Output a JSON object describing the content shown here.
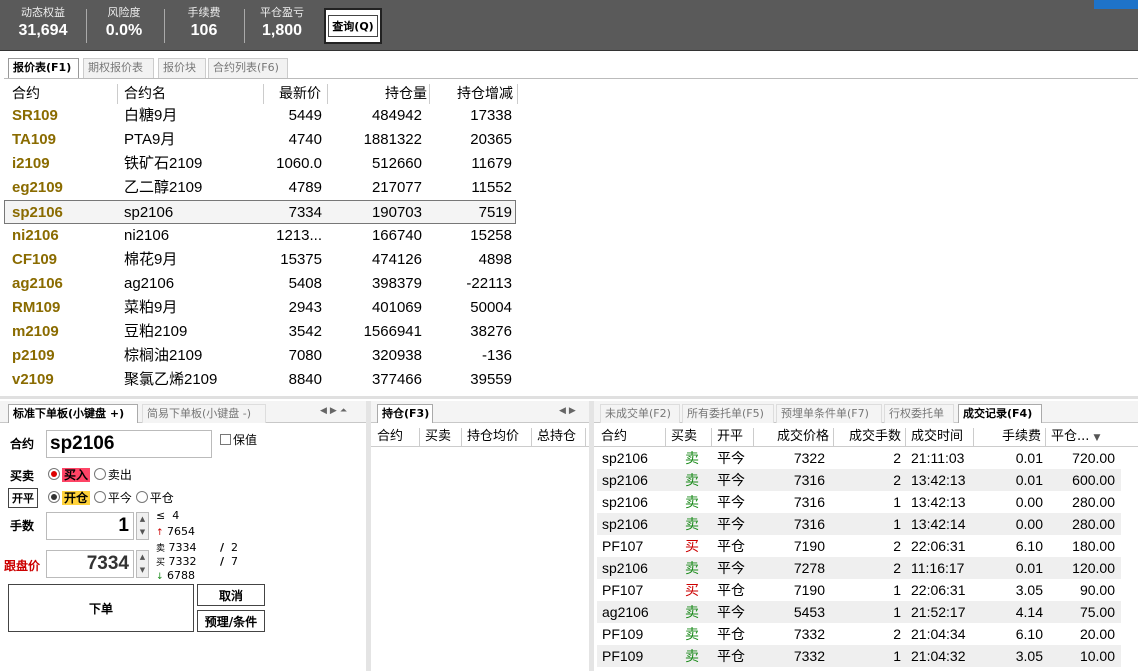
{
  "stats": [
    {
      "label": "动态权益",
      "value": "31,694"
    },
    {
      "label": "风险度",
      "value": "0.0%"
    },
    {
      "label": "手续费",
      "value": "106"
    },
    {
      "label": "平仓盈亏",
      "value": "1,800"
    }
  ],
  "query_button": "查询(Q)",
  "quote_tabs": [
    "报价表(F1)",
    "期权报价表",
    "报价块",
    "合约列表(F6)"
  ],
  "quote_headers": [
    "合约",
    "合约名",
    "最新价",
    "持仓量",
    "持仓增减"
  ],
  "quotes": [
    [
      "SR109",
      "白糖9月",
      "5449",
      "484942",
      "17338"
    ],
    [
      "TA109",
      "PTA9月",
      "4740",
      "1881322",
      "20365"
    ],
    [
      "i2109",
      "铁矿石2109",
      "1060.0",
      "512660",
      "11679"
    ],
    [
      "eg2109",
      "乙二醇2109",
      "4789",
      "217077",
      "11552"
    ],
    [
      "sp2106",
      "sp2106",
      "7334",
      "190703",
      "7519"
    ],
    [
      "ni2106",
      "ni2106",
      "1213...",
      "166740",
      "15258"
    ],
    [
      "CF109",
      "棉花9月",
      "15375",
      "474126",
      "4898"
    ],
    [
      "ag2106",
      "ag2106",
      "5408",
      "398379",
      "-22113"
    ],
    [
      "RM109",
      "菜粕9月",
      "2943",
      "401069",
      "50004"
    ],
    [
      "m2109",
      "豆粕2109",
      "3542",
      "1566941",
      "38276"
    ],
    [
      "p2109",
      "棕榈油2109",
      "7080",
      "320938",
      "-136"
    ],
    [
      "v2109",
      "聚氯乙烯2109",
      "8840",
      "377466",
      "39559"
    ]
  ],
  "order_tabs": [
    "标准下单板(小键盘 +)",
    "简易下单板(小键盘 -)"
  ],
  "order": {
    "contract_label": "合约",
    "contract": "sp2106",
    "keep_label": "保值",
    "side_label": "买卖",
    "buy": "买入",
    "sell": "卖出",
    "offset_label": "开平",
    "open": "开仓",
    "close_today": "平今",
    "close": "平仓",
    "qty_label": "手数",
    "qty": "1",
    "price_label": "跟盘价",
    "price": "7334",
    "le": "≤",
    "le_val": "4",
    "up_val": "7654",
    "sell_mark": "卖",
    "sell_px": "7334",
    "sell_qty": "2",
    "buy_mark": "买",
    "buy_px": "7332",
    "buy_qty": "7",
    "down_val": "6788",
    "slash": "/",
    "submit": "下单",
    "cancel": "取消",
    "preset": "预理/条件"
  },
  "position_tab": "持仓(F3)",
  "position_headers": [
    "合约",
    "买卖",
    "持仓均价",
    "总持仓"
  ],
  "trade_tabs": [
    "未成交单(F2)",
    "所有委托单(F5)",
    "预埋单条件单(F7)",
    "行权委托单",
    "成交记录(F4)"
  ],
  "trade_headers": [
    "合约",
    "买卖",
    "开平",
    "成交价格",
    "成交手数",
    "成交时间",
    "手续费",
    "平仓..."
  ],
  "trades": [
    [
      "sp2106",
      "卖",
      "平今",
      "7322",
      "2",
      "21:11:03",
      "0.01",
      "720.00"
    ],
    [
      "sp2106",
      "卖",
      "平今",
      "7316",
      "2",
      "13:42:13",
      "0.01",
      "600.00"
    ],
    [
      "sp2106",
      "卖",
      "平今",
      "7316",
      "1",
      "13:42:13",
      "0.00",
      "280.00"
    ],
    [
      "sp2106",
      "卖",
      "平今",
      "7316",
      "1",
      "13:42:14",
      "0.00",
      "280.00"
    ],
    [
      "PF107",
      "买",
      "平仓",
      "7190",
      "2",
      "22:06:31",
      "6.10",
      "180.00"
    ],
    [
      "sp2106",
      "卖",
      "平今",
      "7278",
      "2",
      "11:16:17",
      "0.01",
      "120.00"
    ],
    [
      "PF107",
      "买",
      "平仓",
      "7190",
      "1",
      "22:06:31",
      "3.05",
      "90.00"
    ],
    [
      "ag2106",
      "卖",
      "平今",
      "5453",
      "1",
      "21:52:17",
      "4.14",
      "75.00"
    ],
    [
      "PF109",
      "卖",
      "平仓",
      "7332",
      "2",
      "21:04:34",
      "6.10",
      "20.00"
    ],
    [
      "PF109",
      "卖",
      "平仓",
      "7332",
      "1",
      "21:04:32",
      "3.05",
      "10.00"
    ]
  ],
  "colors": {
    "topbar": "#5a5a5a",
    "code": "#8a6b00",
    "sell": "#1a8a1a",
    "buy": "#c00000",
    "accent": "#1e73c9"
  }
}
